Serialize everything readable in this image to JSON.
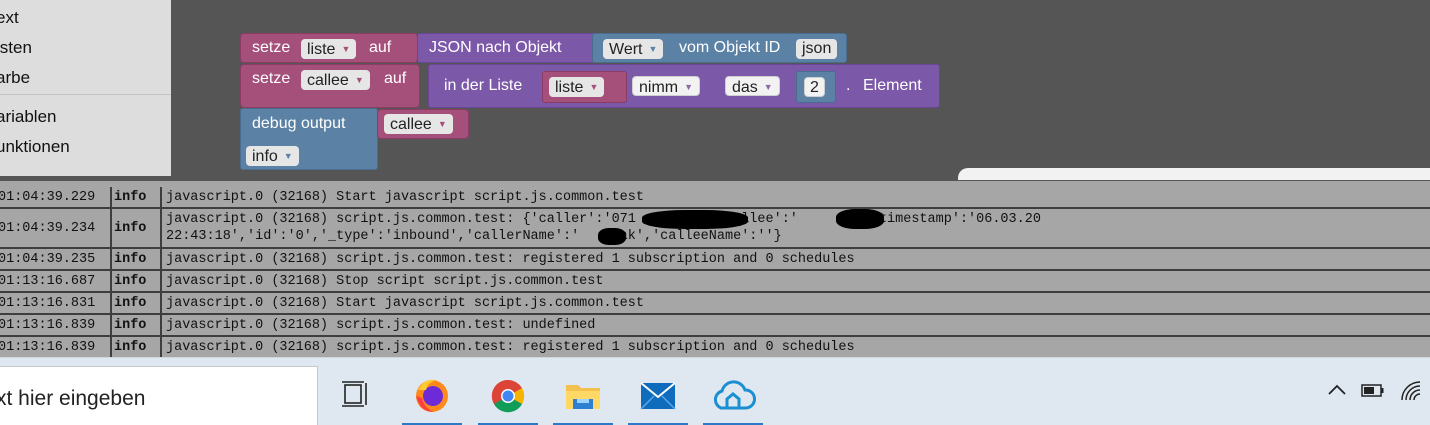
{
  "toolbox": {
    "items": [
      "ext",
      "isten",
      "arbe",
      "ariablen",
      "unktionen"
    ]
  },
  "blocks": {
    "block1": {
      "keyword_setze": "setze",
      "var_liste": "liste",
      "keyword_auf": "auf",
      "json_label": "JSON nach Objekt",
      "wert_field": "Wert",
      "vom_objekt_label": "vom Objekt ID",
      "objekt_id": "json"
    },
    "block2": {
      "keyword_setze": "setze",
      "var_callee": "callee",
      "keyword_auf": "auf",
      "in_der_liste_label": "in der Liste",
      "list_var": "liste",
      "nimm_field": "nimm",
      "das_field": "das",
      "index_value": "2",
      "dot": ".",
      "element_label": "Element"
    },
    "block3": {
      "debug_label": "debug output",
      "var_callee": "callee",
      "level_field": "info"
    }
  },
  "log": {
    "rows": [
      {
        "time": "01:04:39.229",
        "severity": "info",
        "message": "javascript.0 (32168) Start javascript script.js.common.test"
      },
      {
        "time": "01:04:39.234",
        "severity": "info",
        "message": "javascript.0 (32168) script.js.common.test: {'caller':'071        ','callee':'     15','timestamp':'06.03.20\n22:43:18','id':'0','_type':'inbound','callerName':'    zak','calleeName':''}"
      },
      {
        "time": "01:04:39.235",
        "severity": "info",
        "message": "javascript.0 (32168) script.js.common.test: registered 1 subscription and 0 schedules"
      },
      {
        "time": "01:13:16.687",
        "severity": "info",
        "message": "javascript.0 (32168) Stop script script.js.common.test"
      },
      {
        "time": "01:13:16.831",
        "severity": "info",
        "message": "javascript.0 (32168) Start javascript script.js.common.test"
      },
      {
        "time": "01:13:16.839",
        "severity": "info",
        "message": "javascript.0 (32168) script.js.common.test: undefined"
      },
      {
        "time": "01:13:16.839",
        "severity": "info",
        "message": "javascript.0 (32168) script.js.common.test: registered 1 subscription and 0 schedules"
      }
    ]
  },
  "taskbar": {
    "search_text": "xt hier eingeben",
    "apps": [
      "task-view",
      "firefox",
      "chrome",
      "file-explorer",
      "mail",
      "cloud-app"
    ],
    "tray_icons": [
      "chevron-up-icon",
      "battery-icon",
      "wifi-icon"
    ]
  },
  "colors": {
    "workspace_bg": "#555555",
    "toolbox_bg": "#dddddd",
    "variable_block": "#a5507a",
    "json_block": "#7c58a8",
    "debug_block": "#5b81a5",
    "log_bg": "#a6a6a6",
    "taskbar_bg": "#dfe8f1",
    "taskbar_accent": "#2c79c7"
  }
}
